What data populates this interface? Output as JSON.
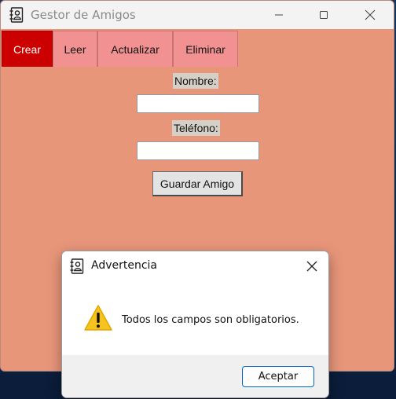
{
  "window": {
    "title": "Gestor de Amigos"
  },
  "tabs": [
    {
      "label": "Crear",
      "active": true
    },
    {
      "label": "Leer",
      "active": false
    },
    {
      "label": "Actualizar",
      "active": false
    },
    {
      "label": "Eliminar",
      "active": false
    }
  ],
  "form": {
    "name_label": "Nombre:",
    "name_value": "",
    "phone_label": "Teléfono:",
    "phone_value": "",
    "save_label": "Guardar Amigo"
  },
  "dialog": {
    "title": "Advertencia",
    "message": "Todos los campos son obligatorios.",
    "ok_label": "Aceptar",
    "icon": "warning-icon"
  },
  "colors": {
    "window_bg": "#e8967a",
    "tab_active": "#cc0000",
    "tab_inactive": "#f19191",
    "dialog_button_border": "#0067c0",
    "warning_yellow": "#f7c31e"
  }
}
